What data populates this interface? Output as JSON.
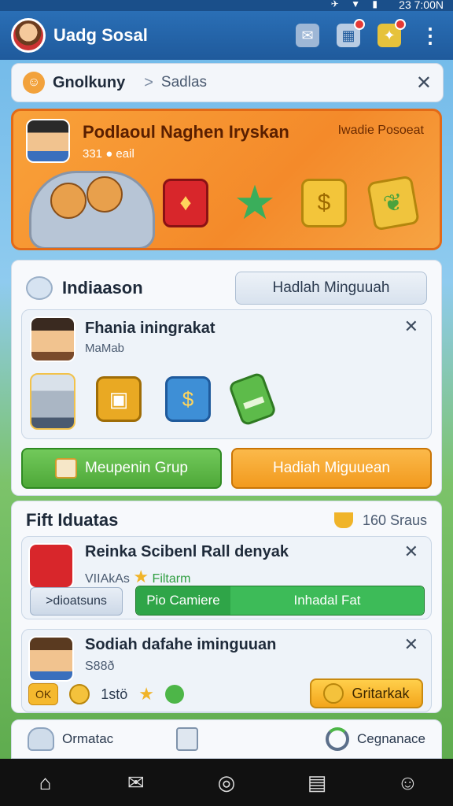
{
  "status": {
    "time": "23 7:00N",
    "icons": "✈ ▼ ▮"
  },
  "appbar": {
    "title": "Uadg Sosal"
  },
  "search": {
    "main": "Gnolkuny",
    "separator": ">",
    "sub": "Sadlas"
  },
  "banner": {
    "title": "Podlaoul Naghen Iryskan",
    "right_text": "Iwadie Posoeat",
    "stats": "331 ● eail"
  },
  "panel1": {
    "title": "Indiaason",
    "button": "Hadlah Minguuah",
    "card": {
      "title": "Fhania iningrakat",
      "subtitle": "MaMab"
    },
    "actions": {
      "green": "Meupenin Grup",
      "orange": "Hadiah Miguuean"
    }
  },
  "panel2": {
    "title": "Fift Iduatas",
    "right_text": "160 Sraus",
    "row1": {
      "title": "Reinka Scibenl Rall denyak",
      "subtitle_prefix": "VIIAkAs",
      "subtitle_accent": "Filtarm",
      "gray_btn": ">dioatsuns",
      "split_left": "Pio Camiere",
      "split_right": "Inhadal Fat"
    },
    "row2": {
      "title": "Sodiah dafahe iminguuan",
      "subtitle": "S88ð",
      "chip": "OK",
      "coin_text": "1stö",
      "gold_btn": "Gritarkak"
    }
  },
  "bottom_panel": {
    "left": "Ormatac",
    "right": "Cegnanace"
  },
  "colors": {
    "appbar": "#1f5a9c",
    "banner": "#f48a2a",
    "green": "#4ea838",
    "orange": "#f29a1e"
  }
}
